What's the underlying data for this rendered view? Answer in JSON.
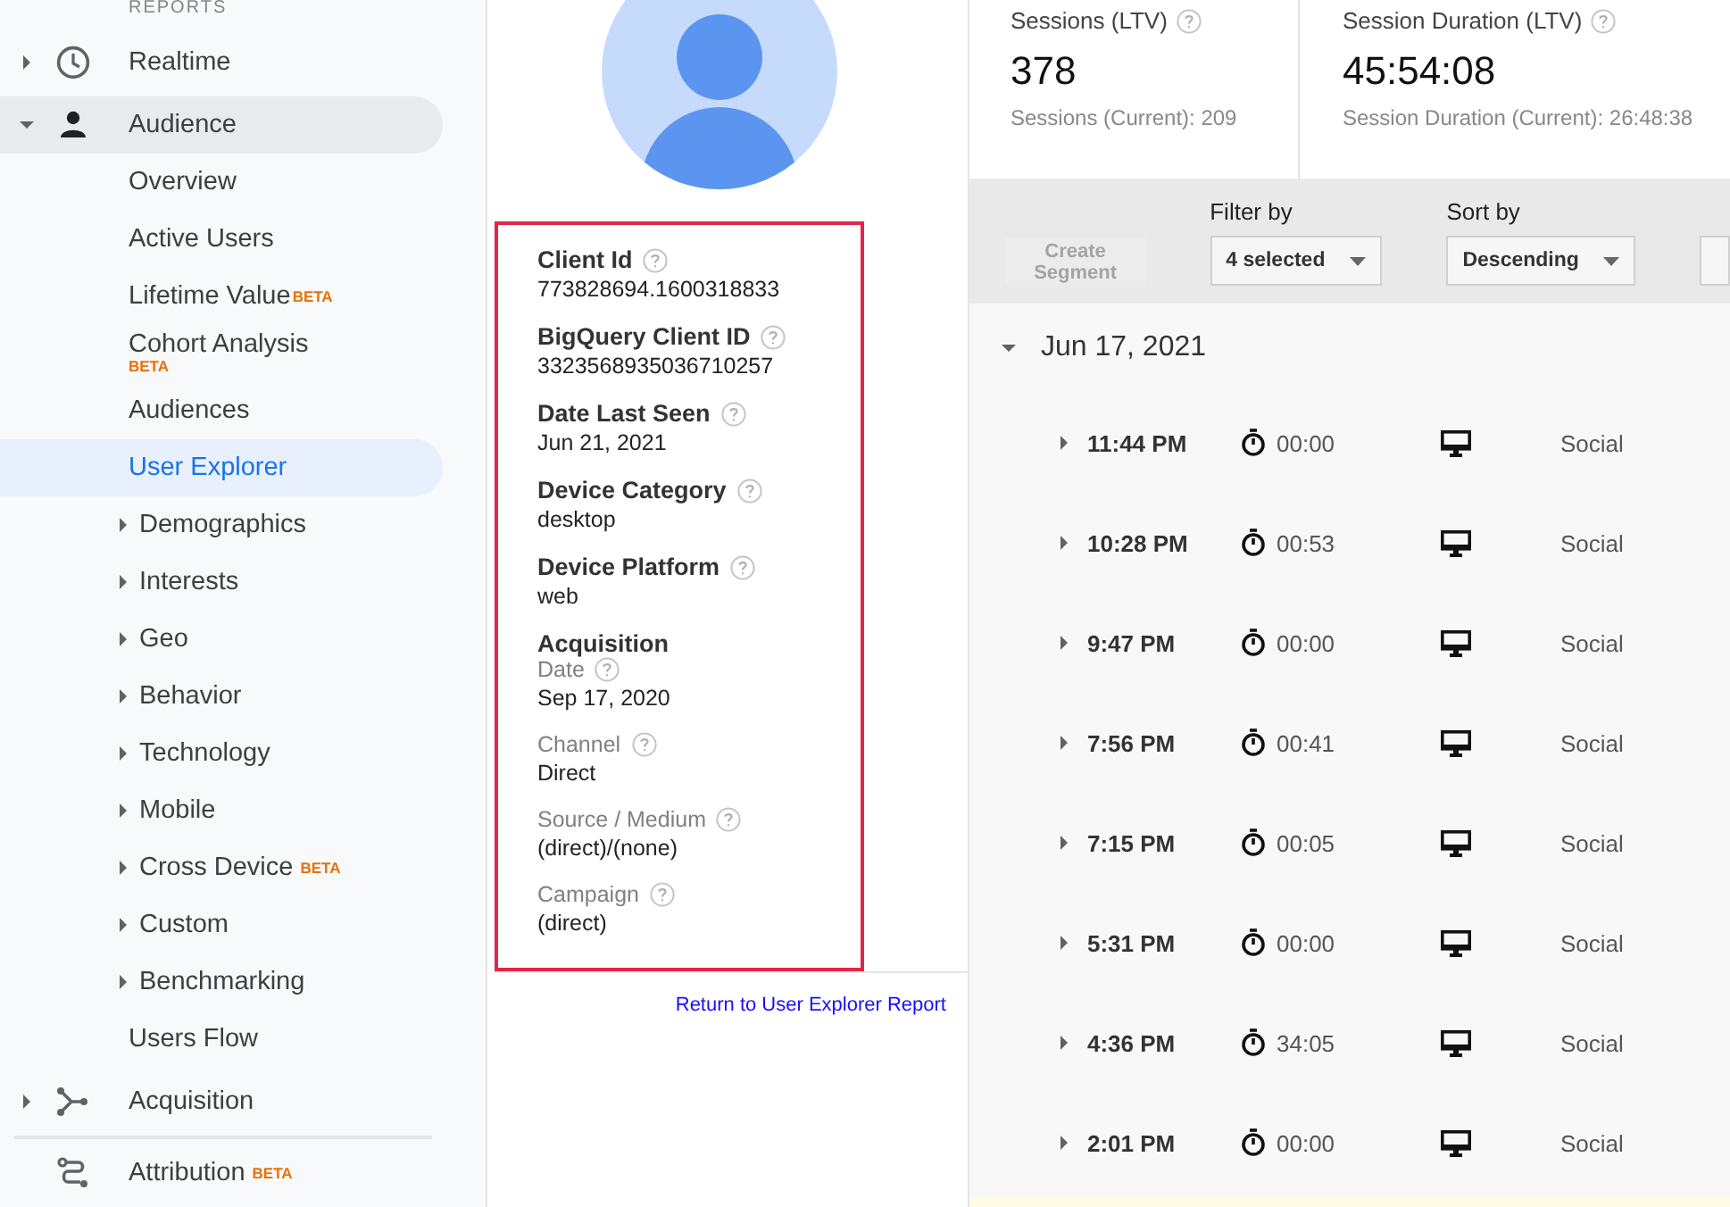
{
  "sidebar": {
    "section_label": "REPORTS",
    "items": [
      {
        "label": "Realtime",
        "kind": "group",
        "expanded": false
      },
      {
        "label": "Audience",
        "kind": "group",
        "expanded": true,
        "children": [
          {
            "label": "Overview",
            "kind": "link",
            "selected": false
          },
          {
            "label": "Active Users",
            "kind": "link",
            "selected": false
          },
          {
            "label": "Lifetime Value",
            "kind": "link",
            "selected": false,
            "badge": "BETA"
          },
          {
            "label": "Cohort Analysis",
            "kind": "stacked",
            "selected": false,
            "badge": "BETA"
          },
          {
            "label": "Audiences",
            "kind": "link",
            "selected": false
          },
          {
            "label": "User Explorer",
            "kind": "link",
            "selected": true
          },
          {
            "label": "Demographics",
            "kind": "group",
            "expanded": false,
            "selected": false
          },
          {
            "label": "Interests",
            "kind": "group",
            "expanded": false,
            "selected": false
          },
          {
            "label": "Geo",
            "kind": "group",
            "expanded": false,
            "selected": false
          },
          {
            "label": "Behavior",
            "kind": "group",
            "expanded": false,
            "selected": false
          },
          {
            "label": "Technology",
            "kind": "group",
            "expanded": false,
            "selected": false
          },
          {
            "label": "Mobile",
            "kind": "group",
            "expanded": false,
            "selected": false
          },
          {
            "label": "Cross Device",
            "kind": "group",
            "expanded": false,
            "selected": false,
            "badge": "BETA"
          },
          {
            "label": "Custom",
            "kind": "group",
            "expanded": false,
            "selected": false
          },
          {
            "label": "Benchmarking",
            "kind": "group",
            "expanded": false,
            "selected": false
          },
          {
            "label": "Users Flow",
            "kind": "link",
            "selected": false
          }
        ]
      },
      {
        "label": "Acquisition",
        "kind": "group",
        "expanded": false
      },
      {
        "label": "Attribution",
        "kind": "link",
        "badge": "BETA"
      }
    ]
  },
  "profile": {
    "fields": [
      {
        "kind": "primary",
        "label": "Client Id",
        "value": "773828694.1600318833"
      },
      {
        "kind": "primary",
        "label": "BigQuery Client ID",
        "value": "3323568935036710257"
      },
      {
        "kind": "primary",
        "label": "Date Last Seen",
        "value": "Jun 21, 2021"
      },
      {
        "kind": "primary",
        "label": "Device Category",
        "value": "desktop"
      },
      {
        "kind": "primary",
        "label": "Device Platform",
        "value": "web"
      },
      {
        "kind": "heading",
        "label": "Acquisition"
      },
      {
        "kind": "secondary",
        "label": "Date",
        "value": "Sep 17, 2020"
      },
      {
        "kind": "secondary",
        "label": "Channel",
        "value": "Direct"
      },
      {
        "kind": "secondary",
        "label": "Source / Medium",
        "value": "(direct)/(none)"
      },
      {
        "kind": "secondary",
        "label": "Campaign",
        "value": "(direct)"
      }
    ],
    "return_link": "Return to User Explorer Report"
  },
  "metrics": [
    {
      "label": "Sessions (LTV)",
      "value": "378",
      "current": "Sessions (Current): 209"
    },
    {
      "label": "Session Duration (LTV)",
      "value": "45:54:08",
      "current": "Session Duration (Current): 26:48:38"
    }
  ],
  "toolbar": {
    "create_segment": {
      "label": "Create Segment",
      "disabled": true
    },
    "dropdowns": [
      {
        "label": "Filter by",
        "value": "4 selected"
      },
      {
        "label": "Sort by",
        "value": "Descending"
      }
    ]
  },
  "activity": {
    "date": "Jun 17, 2021",
    "expanded": true,
    "sessions": [
      {
        "time": "11:44 PM",
        "duration": "00:00",
        "channel": "Social",
        "expanded": false
      },
      {
        "time": "10:28 PM",
        "duration": "00:53",
        "channel": "Social",
        "expanded": false
      },
      {
        "time": "9:47 PM",
        "duration": "00:00",
        "channel": "Social",
        "expanded": false
      },
      {
        "time": "7:56 PM",
        "duration": "00:41",
        "channel": "Social",
        "expanded": false
      },
      {
        "time": "7:15 PM",
        "duration": "00:05",
        "channel": "Social",
        "expanded": false
      },
      {
        "time": "5:31 PM",
        "duration": "00:00",
        "channel": "Social",
        "expanded": false
      },
      {
        "time": "4:36 PM",
        "duration": "34:05",
        "channel": "Social",
        "expanded": false
      },
      {
        "time": "2:01 PM",
        "duration": "00:00",
        "channel": "Social",
        "expanded": false
      }
    ]
  }
}
